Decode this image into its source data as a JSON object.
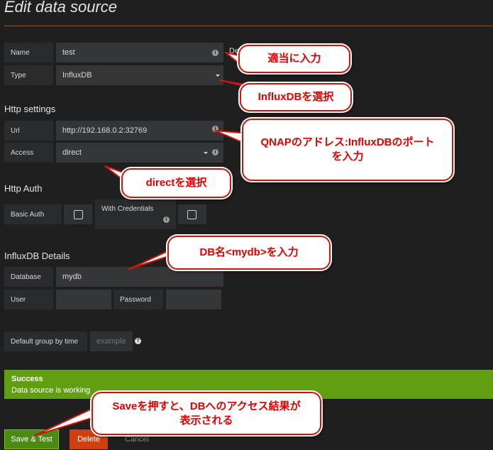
{
  "page": {
    "title": "Edit data source"
  },
  "basic": {
    "name_label": "Name",
    "name_value": "test",
    "name_suffix": "De",
    "type_label": "Type",
    "type_value": "InfluxDB"
  },
  "http": {
    "heading": "Http settings",
    "url_label": "Url",
    "url_value": "http://192.168.0.2:32769",
    "access_label": "Access",
    "access_value": "direct"
  },
  "auth": {
    "heading": "Http Auth",
    "basic_label": "Basic Auth",
    "credentials_label": "With Credentials"
  },
  "influx": {
    "heading": "InfluxDB Details",
    "database_label": "Database",
    "database_value": "mydb",
    "user_label": "User",
    "user_value": "",
    "password_label": "Password",
    "password_value": ""
  },
  "group": {
    "label": "Default group by time",
    "placeholder": "example"
  },
  "alert": {
    "title": "Success",
    "message": "Data source is working"
  },
  "actions": {
    "save": "Save & Test",
    "delete": "Delete",
    "cancel": "Cancel"
  },
  "callouts": {
    "name": "適当に入力",
    "type": "InfluxDBを選択",
    "url": "QNAPのアドレス:InfluxDBのポート\nを入力",
    "access": "directを選択",
    "db": "DB名<mydb>を入力",
    "save": "Saveを押すと、DBへのアクセス結果が\n表示される"
  },
  "colors": {
    "success": "#629e12",
    "delete": "#cf3f0f",
    "save": "#4c8a14",
    "callout_text": "#e00000"
  }
}
